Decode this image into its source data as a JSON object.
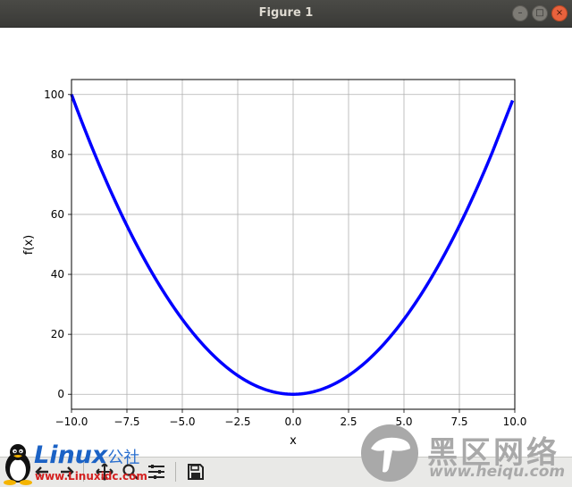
{
  "window": {
    "title": "Figure 1",
    "controls": [
      "minimize",
      "maximize",
      "close"
    ]
  },
  "chart_data": {
    "type": "line",
    "title": "",
    "xlabel": "x",
    "ylabel": "f(x)",
    "xlim": [
      -10,
      10
    ],
    "ylim": [
      -5,
      105
    ],
    "grid": true,
    "xticks": [
      -10,
      -7.5,
      -5,
      -2.5,
      0,
      2.5,
      5,
      7.5,
      10
    ],
    "xtick_labels": [
      "−10.0",
      "−7.5",
      "−5.0",
      "−2.5",
      "0.0",
      "2.5",
      "5.0",
      "7.5",
      "10.0"
    ],
    "yticks": [
      0,
      20,
      40,
      60,
      80,
      100
    ],
    "ytick_labels": [
      "0",
      "20",
      "40",
      "60",
      "80",
      "100"
    ],
    "series": [
      {
        "color": "#0000ff",
        "x": [
          -10,
          -9,
          -8,
          -7,
          -6,
          -5,
          -4,
          -3,
          -2,
          -1,
          0,
          1,
          2,
          3,
          4,
          5,
          6,
          7,
          8,
          9,
          9.9
        ],
        "y": [
          100,
          81,
          64,
          49,
          36,
          25,
          16,
          9,
          4,
          1,
          0,
          1,
          4,
          9,
          16,
          25,
          36,
          49,
          64,
          81,
          98.01
        ]
      }
    ]
  },
  "toolbar": {
    "buttons": [
      {
        "name": "home-icon",
        "glyph": "⌂"
      },
      {
        "name": "back-icon",
        "glyph": "←"
      },
      {
        "name": "forward-icon",
        "glyph": "→"
      },
      {
        "name": "pan-icon",
        "glyph": "✥"
      },
      {
        "name": "zoom-icon",
        "glyph": "⚲"
      },
      {
        "name": "configure-subplots-icon",
        "glyph": "☰"
      },
      {
        "name": "save-icon",
        "glyph": "💾"
      }
    ]
  },
  "watermarks": {
    "left_brand": "Linux",
    "left_suffix": "公社",
    "left_url": "www.Linuxidc.com",
    "right_cn": "黑区网络",
    "right_url": "www.heiqu.com"
  },
  "colors": {
    "line": "#0000ff",
    "grid": "#b0b0b0",
    "titlebar": "#3c3b37",
    "toolbar": "#e9e9e7"
  }
}
